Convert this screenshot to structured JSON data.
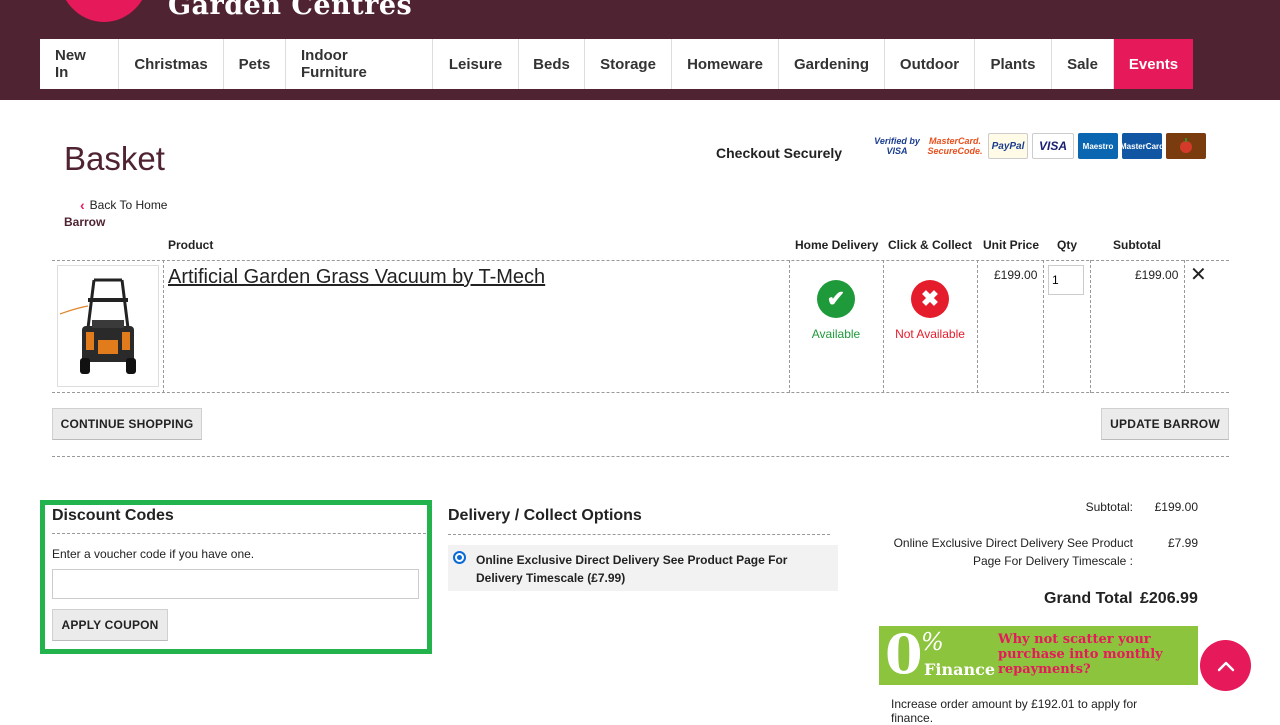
{
  "header": {
    "logo_text": "Garden Centres",
    "nav": [
      "New In",
      "Christmas",
      "Pets",
      "Indoor Furniture",
      "Leisure",
      "Beds",
      "Storage",
      "Homeware",
      "Gardening",
      "Outdoor",
      "Plants",
      "Sale",
      "Events"
    ]
  },
  "page": {
    "title": "Basket",
    "checkout_securely": "Checkout Securely",
    "back_link": "Back To Home",
    "barrow": "Barrow"
  },
  "payment_logos": {
    "vbv_line1": "Verified by",
    "vbv_line2": "VISA",
    "msc_line1": "MasterCard.",
    "msc_line2": "SecureCode.",
    "paypal": "PayPal",
    "visa": "VISA",
    "maestro": "Maestro",
    "mastercard": "MasterCard"
  },
  "table": {
    "headers": {
      "product": "Product",
      "home_delivery": "Home Delivery",
      "click_collect": "Click & Collect",
      "unit_price": "Unit Price",
      "qty": "Qty",
      "subtotal": "Subtotal"
    },
    "item": {
      "title": "Artificial Garden Grass Vacuum by T-Mech",
      "home_delivery_status": "Available",
      "click_collect_status": "Not Available",
      "unit_price": "£199.00",
      "qty": "1",
      "subtotal": "£199.00"
    }
  },
  "buttons": {
    "continue_shopping": "CONTINUE SHOPPING",
    "update_barrow": "UPDATE BARROW",
    "apply_coupon": "APPLY COUPON"
  },
  "discount": {
    "title": "Discount Codes",
    "hint": "Enter a voucher code if you have one.",
    "placeholder": ""
  },
  "delivery": {
    "title": "Delivery / Collect Options",
    "option": "Online Exclusive Direct Delivery See Product Page For Delivery Timescale (£7.99)"
  },
  "summary": {
    "subtotal_label": "Subtotal:",
    "subtotal_value": "£199.00",
    "delivery_label_line1": "Online Exclusive Direct Delivery See Product",
    "delivery_label_line2": "Page For Delivery Timescale :",
    "delivery_value": "£7.99",
    "grand_total_label": "Grand Total",
    "grand_total_value": "£206.99"
  },
  "finance": {
    "zero": "0",
    "percent": "%",
    "word": "Finance",
    "message": "Why not scatter your purchase into monthly repayments?",
    "note": "Increase order amount by £192.01 to apply for finance."
  },
  "icons": {
    "tick": "✔",
    "cross": "✖",
    "remove": "✕",
    "back_chevron": "‹"
  },
  "colors": {
    "header_bg": "#4f2332",
    "accent_pink": "#e6195b",
    "available_green": "#1f9a3a",
    "unavailable_red": "#e51c2c",
    "highlight_green": "#22b34c",
    "finance_green": "#8cc43e"
  }
}
